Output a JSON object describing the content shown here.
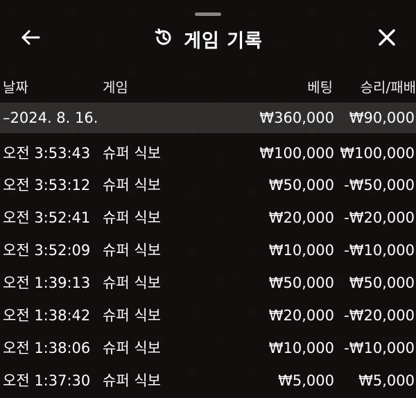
{
  "header": {
    "title": "게임 기록",
    "back_icon": "arrow-left-icon",
    "history_icon": "history-icon",
    "close_icon": "close-icon"
  },
  "columns": {
    "date": "날짜",
    "game": "게임",
    "bet": "베팅",
    "win_loss": "승리/패배"
  },
  "summary": {
    "date": "–2024. 8. 16.",
    "bet": "₩360,000",
    "win_loss": "₩90,000"
  },
  "rows": [
    {
      "time": "오전 3:53:43",
      "game": "슈퍼 식보",
      "bet": "₩100,000",
      "win_loss": "₩100,000"
    },
    {
      "time": "오전 3:53:12",
      "game": "슈퍼 식보",
      "bet": "₩50,000",
      "win_loss": "-₩50,000"
    },
    {
      "time": "오전 3:52:41",
      "game": "슈퍼 식보",
      "bet": "₩20,000",
      "win_loss": "-₩20,000"
    },
    {
      "time": "오전 3:52:09",
      "game": "슈퍼 식보",
      "bet": "₩10,000",
      "win_loss": "-₩10,000"
    },
    {
      "time": "오전 1:39:13",
      "game": "슈퍼 식보",
      "bet": "₩50,000",
      "win_loss": "₩50,000"
    },
    {
      "time": "오전 1:38:42",
      "game": "슈퍼 식보",
      "bet": "₩20,000",
      "win_loss": "-₩20,000"
    },
    {
      "time": "오전 1:38:06",
      "game": "슈퍼 식보",
      "bet": "₩10,000",
      "win_loss": "-₩10,000"
    },
    {
      "time": "오전 1:37:30",
      "game": "슈퍼 식보",
      "bet": "₩5,000",
      "win_loss": "₩5,000"
    }
  ]
}
